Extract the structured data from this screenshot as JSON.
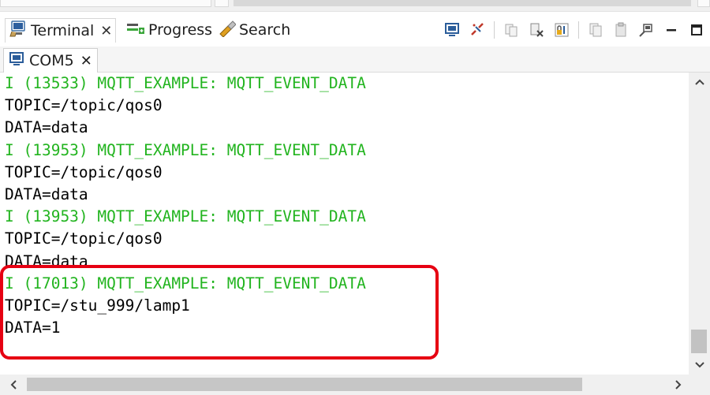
{
  "view_tabs": [
    {
      "label": "Terminal",
      "icon": "terminal-icon",
      "active": true
    },
    {
      "label": "Progress",
      "icon": "progress-icon"
    },
    {
      "label": "Search",
      "icon": "search-flashlight-icon"
    }
  ],
  "console_tab": {
    "label": "COM5",
    "icon": "console-icon"
  },
  "terminal_lines": [
    {
      "text": "I (13533) MQTT_EXAMPLE: MQTT_EVENT_DATA",
      "kind": "info"
    },
    {
      "text": "TOPIC=/topic/qos0",
      "kind": "plain"
    },
    {
      "text": "DATA=data",
      "kind": "plain"
    },
    {
      "text": "I (13953) MQTT_EXAMPLE: MQTT_EVENT_DATA",
      "kind": "info"
    },
    {
      "text": "TOPIC=/topic/qos0",
      "kind": "plain"
    },
    {
      "text": "DATA=data",
      "kind": "plain"
    },
    {
      "text": "I (13953) MQTT_EXAMPLE: MQTT_EVENT_DATA",
      "kind": "info"
    },
    {
      "text": "TOPIC=/topic/qos0",
      "kind": "plain"
    },
    {
      "text": "DATA=data",
      "kind": "plain"
    },
    {
      "text": "I (17013) MQTT_EXAMPLE: MQTT_EVENT_DATA",
      "kind": "info"
    },
    {
      "text": "TOPIC=/stu_999/lamp1",
      "kind": "plain"
    },
    {
      "text": "DATA=1",
      "kind": "plain"
    }
  ],
  "colors": {
    "info_green": "#22b41f",
    "highlight_red": "#e60012"
  }
}
